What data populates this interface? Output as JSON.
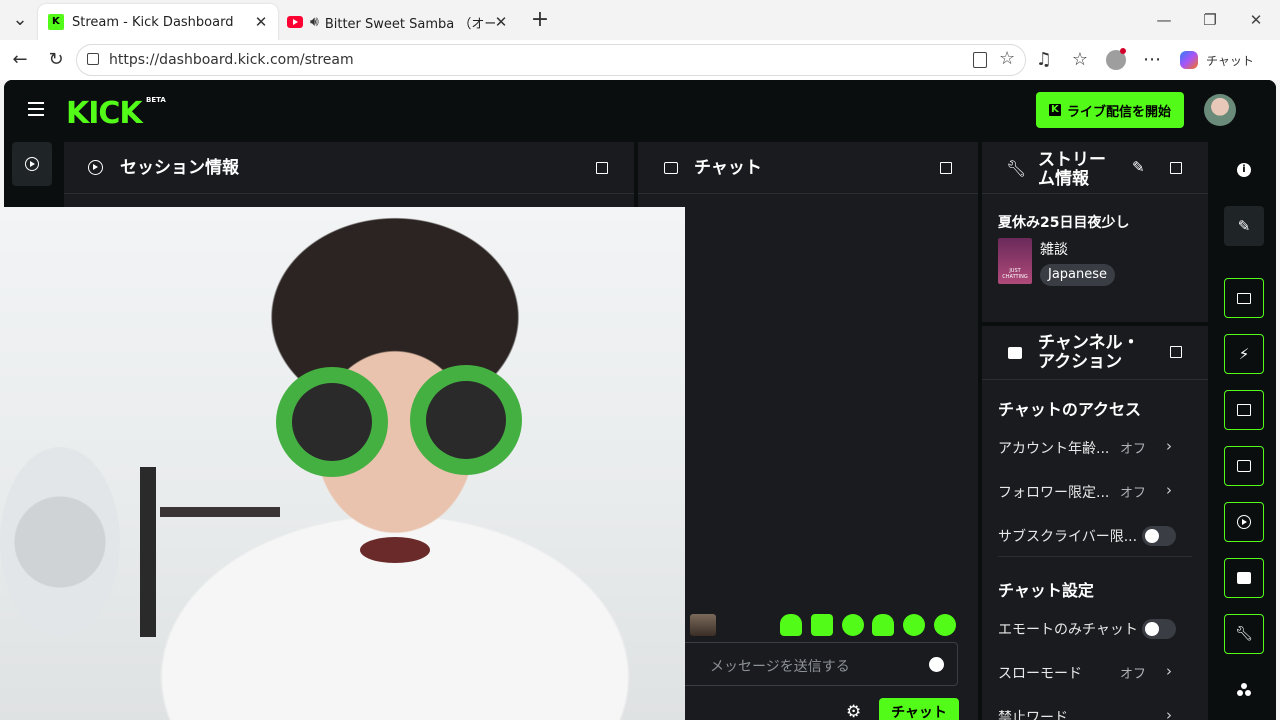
{
  "browser": {
    "tabs": [
      {
        "title": "Stream - Kick Dashboard",
        "active": true
      },
      {
        "title": "Bitter Sweet Samba （オールナ",
        "active": false
      }
    ],
    "url": "https://dashboard.kick.com/stream",
    "copilot_label": "チャット"
  },
  "app": {
    "logo": "KICK",
    "beta": "BETA",
    "go_live_label": "ライブ配信を開始"
  },
  "panels": {
    "session": {
      "title": "セッション情報"
    },
    "chat": {
      "title": "チャット",
      "placeholder": "メッセージを送信する",
      "send_label": "チャット"
    },
    "stream_info": {
      "title_line1": "ストリー",
      "title_line2": "ム情報",
      "stream_title": "夏休み25日目夜少し",
      "category": "雑談",
      "category_thumb_text": "JUST CHATTING",
      "language": "Japanese"
    },
    "channel_actions": {
      "title_line1": "チャンネル・",
      "title_line2": "アクション",
      "chat_access_heading": "チャットのアクセス",
      "chat_access_rows": [
        {
          "label": "アカウント年齢...",
          "value": "オフ"
        },
        {
          "label": "フォロワー限定...",
          "value": "オフ"
        },
        {
          "label": "サブスクライバー限...",
          "value": ""
        }
      ],
      "chat_settings_heading": "チャット設定",
      "chat_settings_rows": [
        {
          "label": "エモートのみチャット",
          "value": ""
        },
        {
          "label": "スローモード",
          "value": "オフ"
        },
        {
          "label": "禁止ワード",
          "value": ""
        }
      ]
    }
  },
  "colors": {
    "accent": "#53fc18",
    "app_bg": "#0b0e0f",
    "panel_bg": "#191b1f"
  }
}
